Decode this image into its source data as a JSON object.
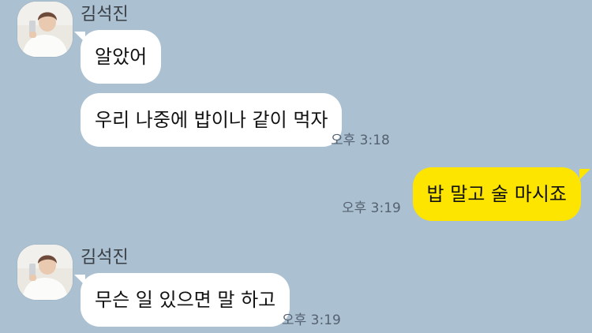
{
  "colors": {
    "chat_background": "#abc1d1",
    "incoming_bubble": "#ffffff",
    "outgoing_bubble": "#fee500"
  },
  "messages": {
    "group1": {
      "sender": "김석진",
      "avatar_icon": "profile-photo-avatar",
      "lines": [
        "알았어",
        "우리 나중에 밥이나 같이 먹자"
      ],
      "time": "오후 3:18"
    },
    "mine1": {
      "text": "밥 말고 술 마시죠",
      "time": "오후 3:19"
    },
    "group2": {
      "sender": "김석진",
      "avatar_icon": "profile-photo-avatar",
      "lines": [
        "무슨 일 있으면 말 하고"
      ],
      "time": "오후 3:19"
    }
  }
}
